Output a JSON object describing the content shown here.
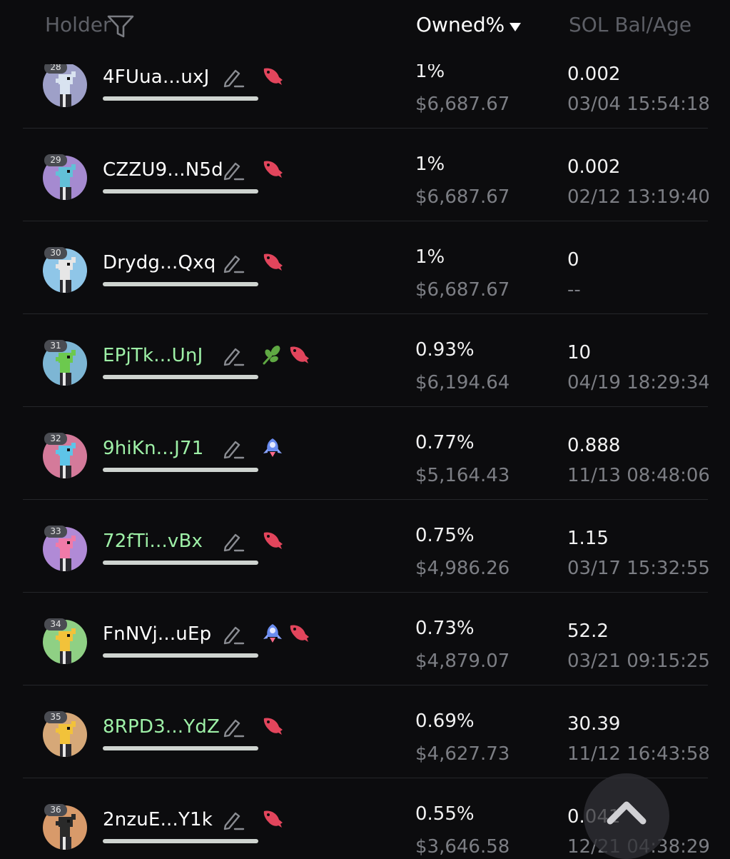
{
  "header": {
    "holder_label": "Holder",
    "owned_label": "Owned%",
    "sol_label": "SOL Bal/Age"
  },
  "rows": [
    {
      "rank": "28",
      "address": "4FUua...uxJ",
      "address_color": "#ffffff",
      "avatar_bg": "#9ea0c8",
      "avatar_fg": "#d9e3f0",
      "owned": "1%",
      "usd": "$6,687.67",
      "sol": "0.002",
      "age": "03/04 15:54:18",
      "icons": [
        "fish-icon"
      ]
    },
    {
      "rank": "29",
      "address": "CZZU9...N5d",
      "address_color": "#ffffff",
      "avatar_bg": "#a58ad0",
      "avatar_fg": "#62c0d8",
      "owned": "1%",
      "usd": "$6,687.67",
      "sol": "0.002",
      "age": "02/12 13:19:40",
      "icons": [
        "fish-icon"
      ]
    },
    {
      "rank": "30",
      "address": "Drydg...Qxq",
      "address_color": "#ffffff",
      "avatar_bg": "#8fc6e8",
      "avatar_fg": "#e6e6e6",
      "owned": "1%",
      "usd": "$6,687.67",
      "sol": "0",
      "age": "--",
      "icons": [
        "fish-icon"
      ]
    },
    {
      "rank": "31",
      "address": "EPjTk...UnJ",
      "address_color": "#9ef0a7",
      "avatar_bg": "#7db6d4",
      "avatar_fg": "#6cc94e",
      "owned": "0.93%",
      "usd": "$6,194.64",
      "sol": "10",
      "age": "04/19 18:29:34",
      "icons": [
        "herb-icon",
        "fish-icon"
      ]
    },
    {
      "rank": "32",
      "address": "9hiKn...J71",
      "address_color": "#9ef0a7",
      "avatar_bg": "#d47a9a",
      "avatar_fg": "#5ec4e8",
      "owned": "0.77%",
      "usd": "$5,164.43",
      "sol": "0.888",
      "age": "11/13 08:48:06",
      "icons": [
        "rocket-icon"
      ]
    },
    {
      "rank": "33",
      "address": "72fTi...vBx",
      "address_color": "#9ef0a7",
      "avatar_bg": "#b08ad6",
      "avatar_fg": "#f07aa8",
      "owned": "0.75%",
      "usd": "$4,986.26",
      "sol": "1.15",
      "age": "03/17 15:32:55",
      "icons": [
        "fish-icon"
      ]
    },
    {
      "rank": "34",
      "address": "FnNVj...uEp",
      "address_color": "#ffffff",
      "avatar_bg": "#8fd084",
      "avatar_fg": "#f2c23a",
      "owned": "0.73%",
      "usd": "$4,879.07",
      "sol": "52.2",
      "age": "03/21 09:15:25",
      "icons": [
        "rocket-icon",
        "fish-icon"
      ]
    },
    {
      "rank": "35",
      "address": "8RPD3...YdZ",
      "address_color": "#9ef0a7",
      "avatar_bg": "#d6a878",
      "avatar_fg": "#f2c23a",
      "owned": "0.69%",
      "usd": "$4,627.73",
      "sol": "30.39",
      "age": "11/12 16:43:58",
      "icons": [
        "fish-icon"
      ]
    },
    {
      "rank": "36",
      "address": "2nzuE...Y1k",
      "address_color": "#ffffff",
      "avatar_bg": "#d89a6a",
      "avatar_fg": "#2a2a2a",
      "owned": "0.55%",
      "usd": "$3,646.58",
      "sol": "0.041",
      "age": "12/21 04:38:29",
      "icons": [
        "fish-icon"
      ]
    }
  ],
  "icon_colors": {
    "fish": "#e2455c",
    "herb": "#5fa843",
    "rocket": "#6a8cf0"
  },
  "scroll_top": {
    "icon": "chevron-up-icon"
  }
}
